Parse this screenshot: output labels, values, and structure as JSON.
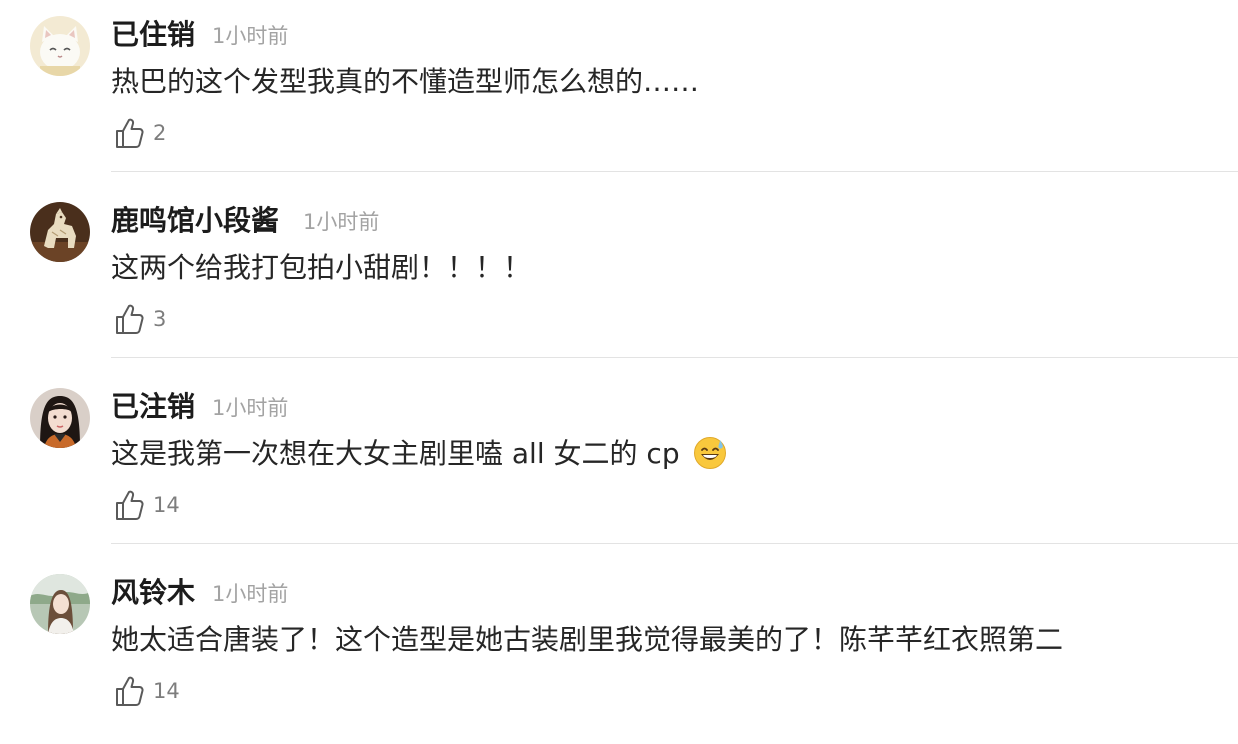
{
  "comments": [
    {
      "username": "已住销",
      "time": "1小时前",
      "text": "热巴的这个发型我真的不懂造型师怎么想的……",
      "likes": "2",
      "avatar_icon": "cat-avatar-icon"
    },
    {
      "username": "鹿鸣馆小段酱",
      "time": "1小时前",
      "text": "这两个给我打包拍小甜剧！！！！",
      "likes": "3",
      "avatar_icon": "horse-statue-avatar-icon"
    },
    {
      "username": "已注销",
      "time": "1小时前",
      "text": "这是我第一次想在大女主剧里嗑 all 女二的 cp",
      "likes": "14",
      "avatar_icon": "woman-portrait-avatar-icon",
      "emoji": "grinning-sweat-emoji"
    },
    {
      "username": "风铃木",
      "time": "1小时前",
      "text": "她太适合唐装了！这个造型是她古装剧里我觉得最美的了！陈芊芊红衣照第二",
      "likes": "14",
      "avatar_icon": "woman-outdoor-avatar-icon"
    }
  ],
  "colors": {
    "username": "#1c1c1c",
    "time": "#a3a3a3",
    "text": "#262626",
    "like_count": "#7d7d7d",
    "divider": "#e3e3e3"
  }
}
